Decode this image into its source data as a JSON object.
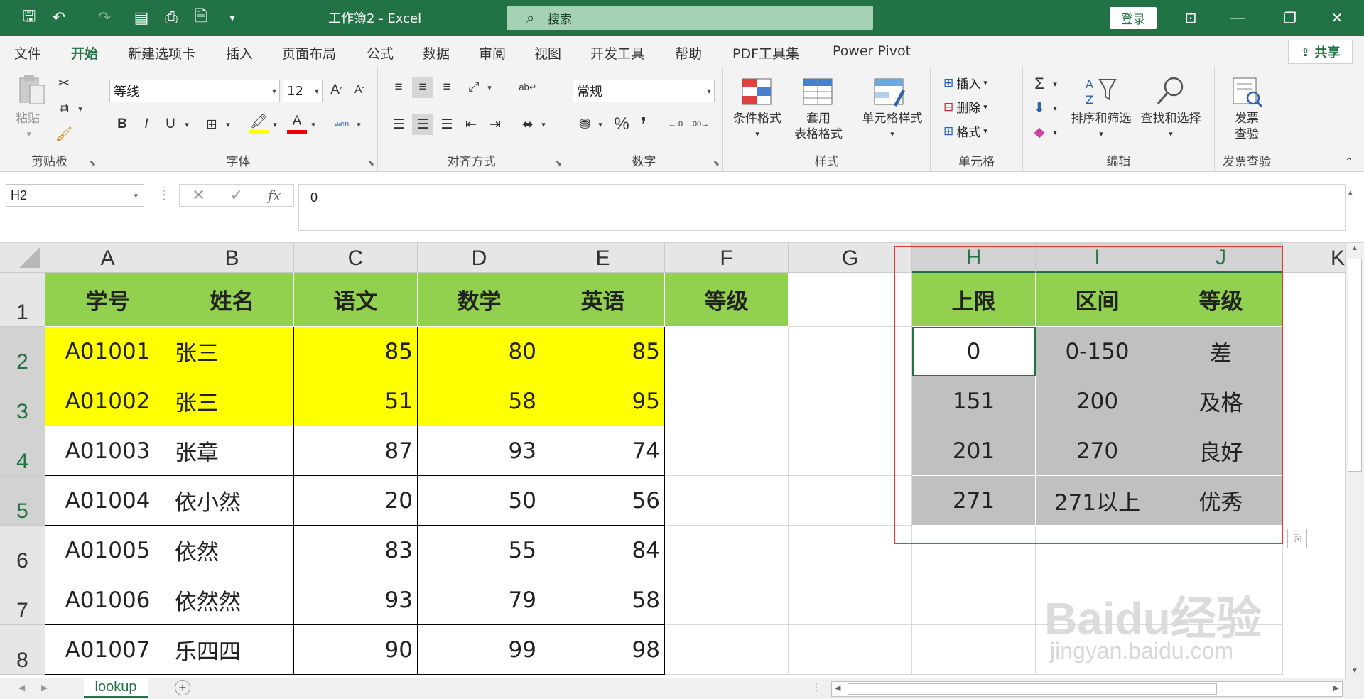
{
  "titlebar": {
    "title": "工作簿2  -  Excel",
    "search_placeholder": "搜索",
    "login_label": "登录"
  },
  "tabs": [
    "文件",
    "开始",
    "新建选项卡",
    "插入",
    "页面布局",
    "公式",
    "数据",
    "审阅",
    "视图",
    "开发工具",
    "帮助",
    "PDF工具集",
    "Power Pivot"
  ],
  "active_tab": "开始",
  "share_label": "共享",
  "ribbon": {
    "clipboard": {
      "label": "剪贴板",
      "paste": "粘贴"
    },
    "font": {
      "label": "字体",
      "font_name": "等线",
      "font_size": "12",
      "bold": "B",
      "italic": "I",
      "underline": "U"
    },
    "alignment": {
      "label": "对齐方式"
    },
    "number": {
      "label": "数字",
      "format": "常规"
    },
    "styles": {
      "label": "样式",
      "conditional": "条件格式",
      "table_line1": "套用",
      "table_line2": "表格格式",
      "cell_styles": "单元格样式"
    },
    "cells": {
      "label": "单元格",
      "insert": "插入",
      "delete": "删除",
      "format": "格式"
    },
    "editing": {
      "label": "编辑",
      "sort": "排序和筛选",
      "find": "查找和选择"
    },
    "invoice": {
      "label": "发票查验",
      "btn_line1": "发票",
      "btn_line2": "查验"
    }
  },
  "formula_bar": {
    "name_box": "H2",
    "formula": "0"
  },
  "columns": [
    "A",
    "B",
    "C",
    "D",
    "E",
    "F",
    "G",
    "H",
    "I",
    "J"
  ],
  "rows": [
    "1",
    "2",
    "3",
    "4",
    "5",
    "6",
    "7",
    "8"
  ],
  "table_headers": [
    "学号",
    "姓名",
    "语文",
    "数学",
    "英语",
    "等级"
  ],
  "students": [
    {
      "id": "A01001",
      "name": "张三",
      "chinese": "85",
      "math": "80",
      "english": "85"
    },
    {
      "id": "A01002",
      "name": "张三",
      "chinese": "51",
      "math": "58",
      "english": "95"
    },
    {
      "id": "A01003",
      "name": "张章",
      "chinese": "87",
      "math": "93",
      "english": "74"
    },
    {
      "id": "A01004",
      "name": "依小然",
      "chinese": "20",
      "math": "50",
      "english": "56"
    },
    {
      "id": "A01005",
      "name": "依然",
      "chinese": "83",
      "math": "55",
      "english": "84"
    },
    {
      "id": "A01006",
      "name": "依然然",
      "chinese": "93",
      "math": "79",
      "english": "58"
    },
    {
      "id": "A01007",
      "name": "乐四四",
      "chinese": "90",
      "math": "99",
      "english": "98"
    }
  ],
  "lookup_headers": [
    "上限",
    "区间",
    "等级"
  ],
  "lookup_rows": [
    {
      "limit": "0",
      "range": "0-150",
      "grade": "差"
    },
    {
      "limit": "151",
      "range": "200",
      "grade": "及格"
    },
    {
      "limit": "201",
      "range": "270",
      "grade": "良好"
    },
    {
      "limit": "271",
      "range": "271以上",
      "grade": "优秀"
    }
  ],
  "sheet_tab": "lookup",
  "watermark": {
    "line1": "Baidu经验",
    "line2": "jingyan.baidu.com"
  },
  "colors": {
    "accent": "#217346",
    "header_green": "#92d050",
    "highlight_yellow": "#ffff00",
    "lookup_gray": "#c0c0c0",
    "annotation_red": "#e53935"
  }
}
